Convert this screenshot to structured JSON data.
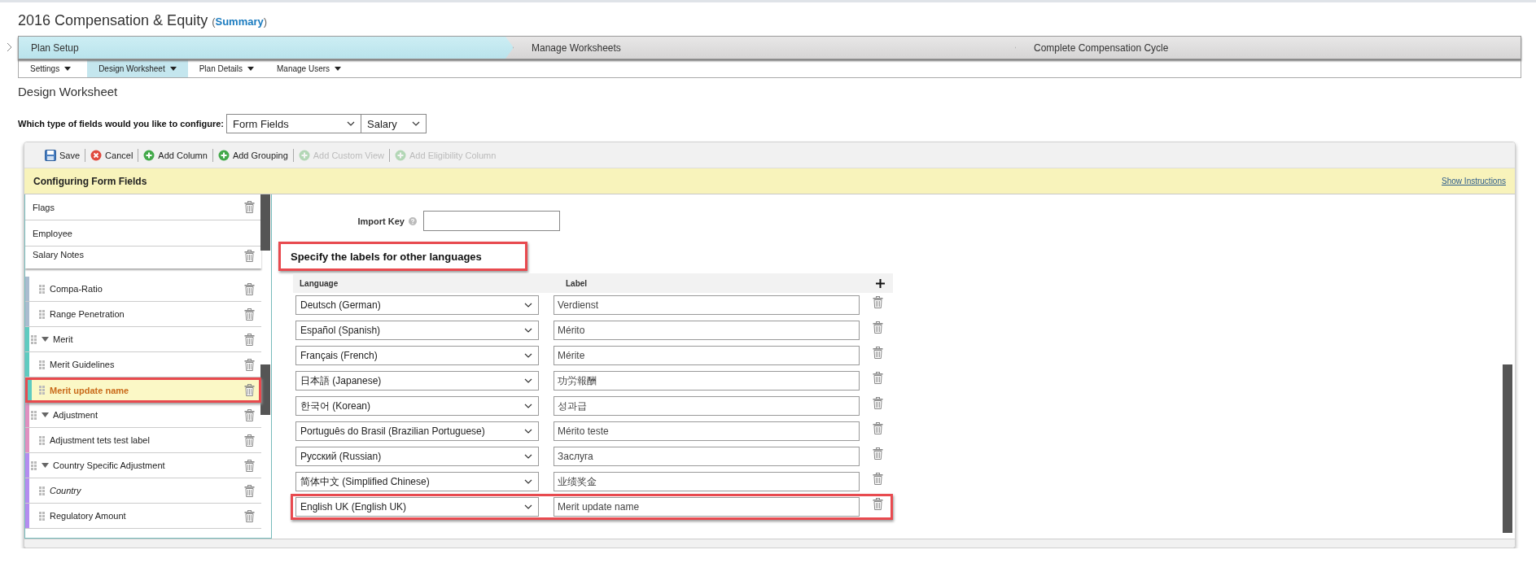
{
  "header": {
    "title": "2016 Compensation & Equity",
    "summary": "(**Summary**)"
  },
  "steps": [
    {
      "label": "Plan Setup",
      "selected": true
    },
    {
      "label": "Manage Worksheets",
      "selected": false
    },
    {
      "label": "Complete Compensation Cycle",
      "selected": false
    }
  ],
  "subnav": [
    {
      "label": "Settings",
      "selected": false
    },
    {
      "label": "Design Worksheet",
      "selected": true
    },
    {
      "label": "Plan Details",
      "selected": false
    },
    {
      "label": "Manage Users",
      "selected": false
    }
  ],
  "section_title": "Design Worksheet",
  "field_type": {
    "label": "Which type of fields would you like to configure:",
    "type_value": "Form Fields",
    "category_value": "Salary"
  },
  "toolbar": [
    {
      "label": "Save",
      "kind": "save",
      "disabled": false
    },
    {
      "label": "Cancel",
      "kind": "cancel",
      "disabled": false
    },
    {
      "label": "Add Column",
      "kind": "add",
      "disabled": false
    },
    {
      "label": "Add Grouping",
      "kind": "add",
      "disabled": false
    },
    {
      "label": "Add Custom View",
      "kind": "add",
      "disabled": true
    },
    {
      "label": "Add Eligibility Column",
      "kind": "add",
      "disabled": true
    }
  ],
  "config_header": {
    "title": "Configuring Form Fields",
    "link": "Show Instructions"
  },
  "field_list": {
    "pinned": [
      {
        "label": "Flags",
        "deletable": true
      },
      {
        "label": "Employee",
        "deletable": false
      },
      {
        "label": "Salary Notes",
        "deletable": true
      }
    ],
    "items": [
      {
        "label": "Compa-Ratio",
        "kind": "field",
        "color": "#a9bccf",
        "selected": false,
        "highlighted": false,
        "italic": false
      },
      {
        "label": "Range Penetration",
        "kind": "field",
        "color": "#a9bccf",
        "selected": false,
        "highlighted": false,
        "italic": false
      },
      {
        "label": "Merit",
        "kind": "group",
        "color": "#5ecbc0",
        "selected": false,
        "highlighted": false,
        "italic": false
      },
      {
        "label": "Merit Guidelines",
        "kind": "field",
        "color": "#5ecbc0",
        "selected": false,
        "highlighted": false,
        "italic": false
      },
      {
        "label": "Merit update name",
        "kind": "field",
        "color": "#5ecbc0",
        "selected": true,
        "highlighted": true,
        "italic": false
      },
      {
        "label": "Adjustment",
        "kind": "group",
        "color": "#e090c0",
        "selected": false,
        "highlighted": false,
        "italic": false
      },
      {
        "label": "Adjustment tets test label",
        "kind": "field",
        "color": "#e090c0",
        "selected": false,
        "highlighted": false,
        "italic": false
      },
      {
        "label": "Country Specific Adjustment",
        "kind": "group",
        "color": "#b48cf0",
        "selected": false,
        "highlighted": false,
        "italic": false
      },
      {
        "label": "Country",
        "kind": "field",
        "color": "#b48cf0",
        "selected": false,
        "highlighted": false,
        "italic": true
      },
      {
        "label": "Regulatory Amount",
        "kind": "field",
        "color": "#b48cf0",
        "selected": false,
        "highlighted": false,
        "italic": false
      }
    ]
  },
  "detail": {
    "import_key_label": "Import Key",
    "heading": "Specify the labels for other languages",
    "heading_highlighted": true,
    "columns": [
      "Language",
      "Label"
    ],
    "rows": [
      {
        "language": "Deutsch (German)",
        "label": "Verdienst",
        "highlighted": false
      },
      {
        "language": "Español (Spanish)",
        "label": "Mérito",
        "highlighted": false
      },
      {
        "language": "Français (French)",
        "label": "Mérite",
        "highlighted": false
      },
      {
        "language": "日本語 (Japanese)",
        "label": "功労報酬",
        "highlighted": false
      },
      {
        "language": "한국어 (Korean)",
        "label": "성과급",
        "highlighted": false
      },
      {
        "language": "Português do Brasil (Brazilian Portuguese)",
        "label": "Mérito teste",
        "highlighted": false
      },
      {
        "language": "Русский (Russian)",
        "label": "Заслуга",
        "highlighted": false
      },
      {
        "language": "简体中文 (Simplified Chinese)",
        "label": "业绩奖金",
        "highlighted": false
      },
      {
        "language": "English UK (English UK)",
        "label": "Merit update name",
        "highlighted": true
      }
    ]
  }
}
